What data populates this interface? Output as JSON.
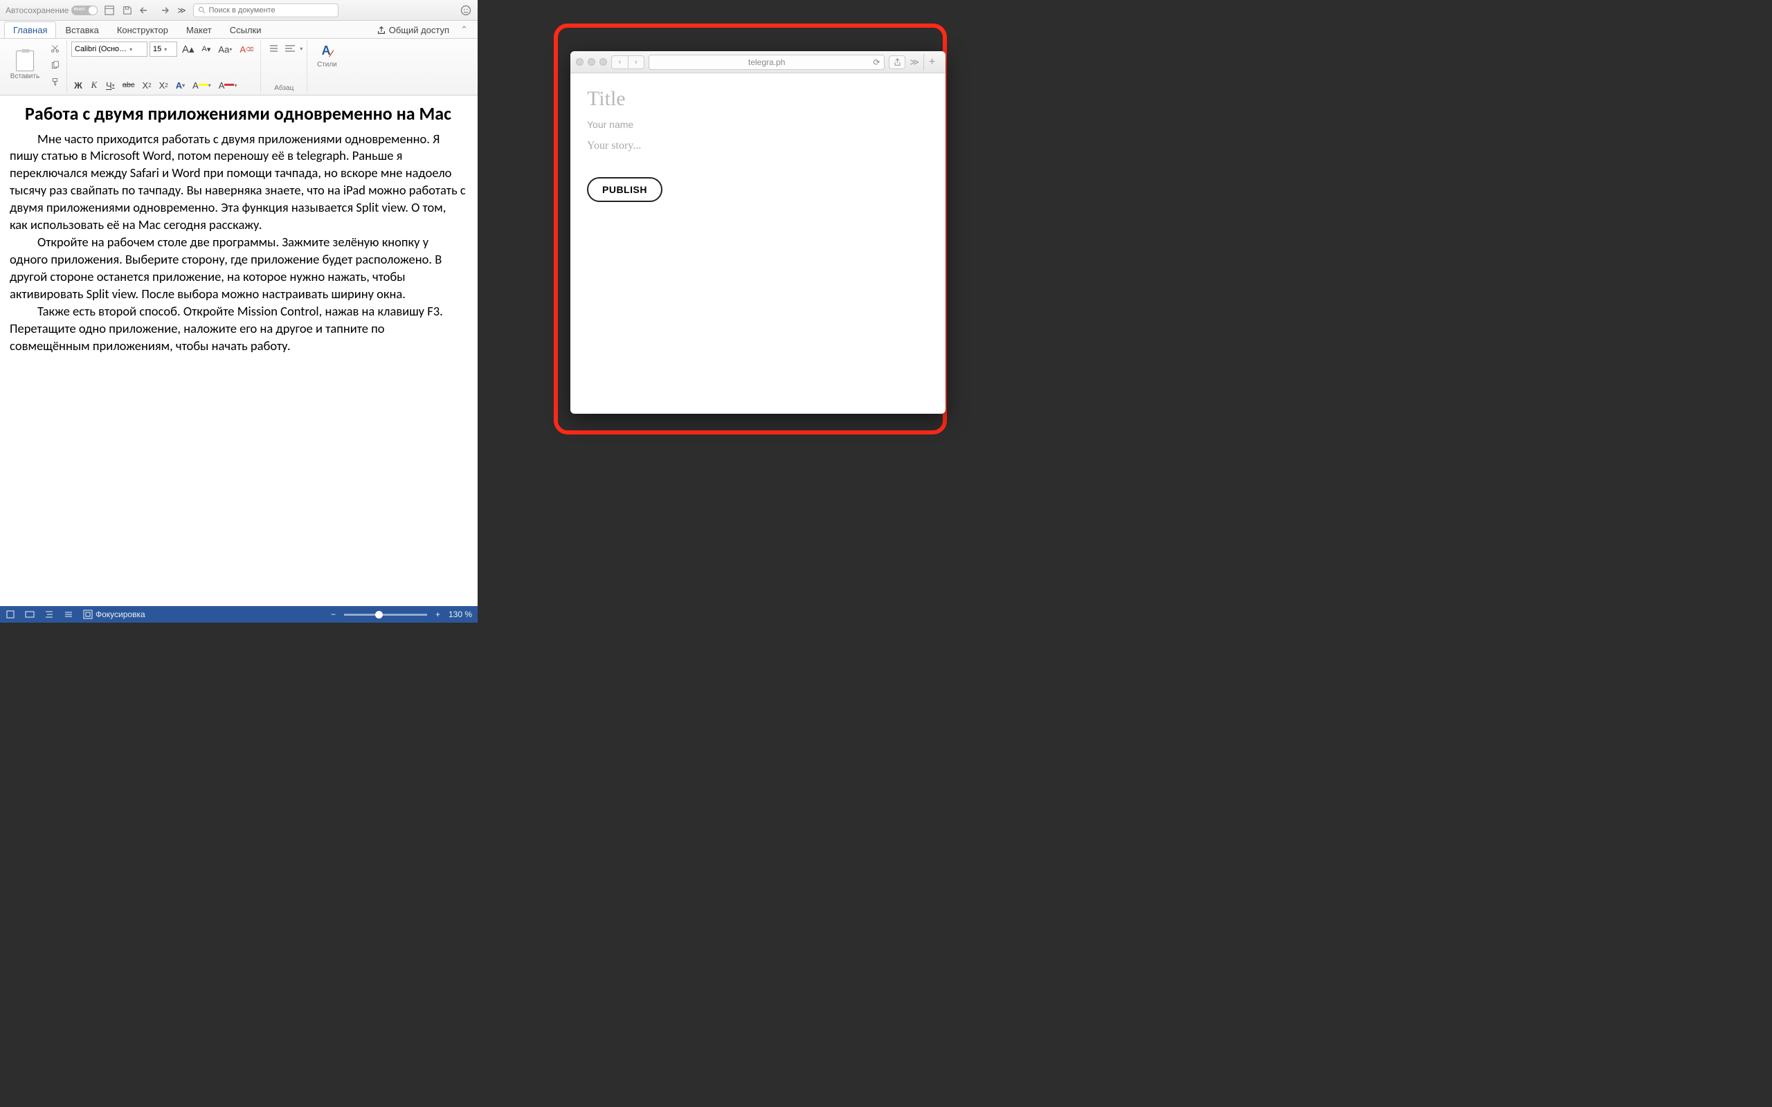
{
  "word": {
    "titlebar": {
      "autosave_label": "Автосохранение",
      "autosave_state": "выкл.",
      "search_placeholder": "Поиск в документе"
    },
    "tabs": {
      "home": "Главная",
      "insert": "Вставка",
      "design": "Конструктор",
      "layout": "Макет",
      "references": "Ссылки",
      "share": "Общий доступ"
    },
    "ribbon": {
      "paste_label": "Вставить",
      "font_name": "Calibri (Осно…",
      "font_size": "15",
      "paragraph_label": "Абзац",
      "styles_label": "Стили",
      "bold": "Ж",
      "italic": "К",
      "underline": "Ч",
      "strike": "abc",
      "sub": "X",
      "sup": "X",
      "a_style": "A",
      "highlight": "A",
      "fontcolor": "A",
      "aa_big": "A",
      "aa_small": "A",
      "aa_case": "Aa",
      "clear": "A"
    },
    "document": {
      "title": "Работа с двумя приложениями одновременно на Mac",
      "p1": "Мне часто приходится работать с двумя приложениями одновременно. Я пишу статью в Microsoft Word, потом переношу её в telegraph. Раньше я переключался между Safari и Word при помощи тачпада, но вскоре мне надоело тысячу раз свайпать по тачпаду. Вы наверняка знаете, что на iPad можно работать с двумя приложениями одновременно. Эта функция называется Split view. О том, как использовать её на Mac сегодня расскажу.",
      "p2": "Откройте на рабочем столе две программы. Зажмите зелёную кнопку у одного приложения. Выберите сторону, где приложение будет расположено. В другой стороне останется приложение, на которое нужно нажать, чтобы активировать Split view. После выбора можно настраивать ширину окна.",
      "p3": "Также есть второй способ. Откройте Mission Control, нажав на клавишу F3. Перетащите одно приложение, наложите его на другое и тапните по совмещённым приложениям, чтобы начать работу."
    },
    "statusbar": {
      "focus": "Фокусировка",
      "zoom": "130 %",
      "minus": "−",
      "plus": "+"
    }
  },
  "safari": {
    "url": "telegra.ph",
    "title_placeholder": "Title",
    "name_placeholder": "Your name",
    "story_placeholder": "Your story...",
    "publish": "PUBLISH"
  }
}
